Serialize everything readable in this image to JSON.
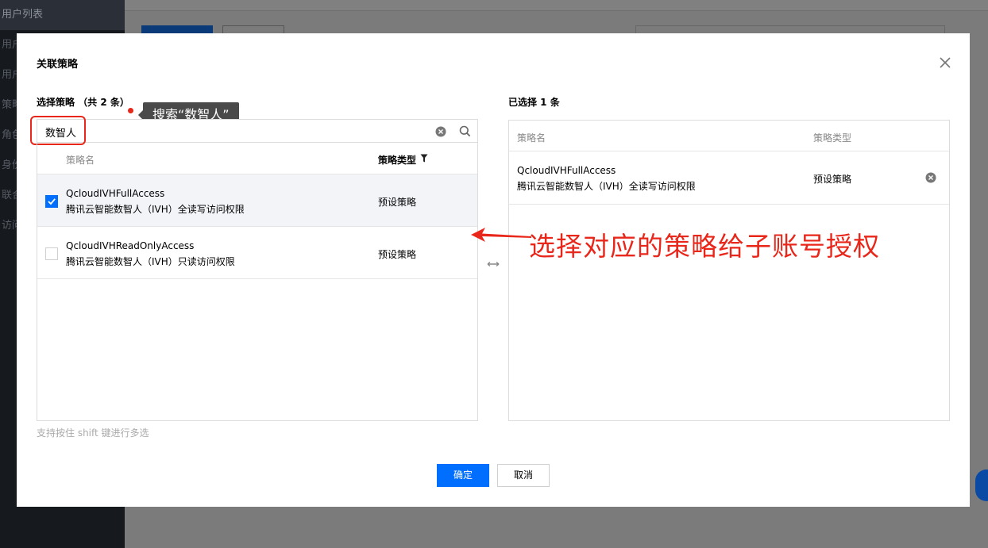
{
  "background": {
    "sidebar_items": [
      "用户列表",
      "用户",
      "用户",
      "策略",
      "角色",
      "身份",
      "联合",
      "访问"
    ]
  },
  "modal": {
    "title": "关联策略",
    "left": {
      "label": "选择策略 （共 2 条）",
      "search_value": "数智人",
      "col_name": "策略名",
      "col_type": "策略类型",
      "rows": [
        {
          "name": "QcloudIVHFullAccess",
          "desc": "腾讯云智能数智人（IVH）全读写访问权限",
          "type": "预设策略",
          "checked": true
        },
        {
          "name": "QcloudIVHReadOnlyAccess",
          "desc": "腾讯云智能数智人（IVH）只读访问权限",
          "type": "预设策略",
          "checked": false
        }
      ],
      "hint": "支持按住 shift 键进行多选"
    },
    "right": {
      "label": "已选择 1 条",
      "col_name": "策略名",
      "col_type": "策略类型",
      "rows": [
        {
          "name": "QcloudIVHFullAccess",
          "desc": "腾讯云智能数智人（IVH）全读写访问权限",
          "type": "预设策略"
        }
      ]
    },
    "confirm_label": "确定",
    "cancel_label": "取消"
  },
  "annotations": {
    "tooltip": "搜索“数智人”",
    "callout": "选择对应的策略给子账号授权",
    "color": "#e8261a"
  },
  "colors": {
    "primary": "#006eff",
    "overlay": "#7b7b7b",
    "sidebar": "#16191e"
  }
}
